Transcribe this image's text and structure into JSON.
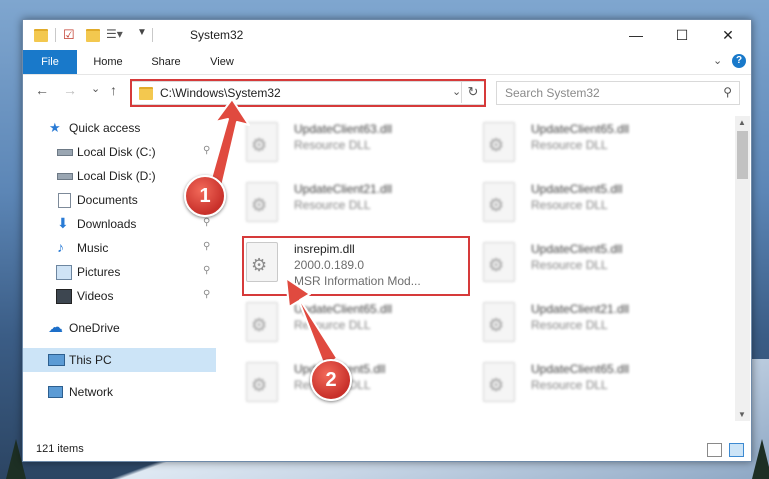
{
  "window": {
    "title": "System32",
    "controls": {
      "minimize": "—",
      "maximize": "☐",
      "close": "✕"
    }
  },
  "ribbon": {
    "tabs": [
      "File",
      "Home",
      "Share",
      "View"
    ],
    "expand_glyph": "⌄",
    "help_glyph": "?"
  },
  "addressbar": {
    "path": "C:\\Windows\\System32",
    "chevron": "⌄",
    "refresh_glyph": "↻"
  },
  "search": {
    "placeholder": "Search System32"
  },
  "nav": {
    "back": "←",
    "forward": "→",
    "recent": "⌄",
    "up": "↑",
    "items": [
      {
        "label": "Quick access",
        "icon": "star-icon",
        "pinned": false
      },
      {
        "label": "Local Disk (C:)",
        "icon": "drive-icon",
        "pinned": true
      },
      {
        "label": "Local Disk (D:)",
        "icon": "drive-icon",
        "pinned": false
      },
      {
        "label": "Documents",
        "icon": "documents-icon",
        "pinned": true
      },
      {
        "label": "Downloads",
        "icon": "download-icon",
        "pinned": true
      },
      {
        "label": "Music",
        "icon": "music-icon",
        "pinned": true
      },
      {
        "label": "Pictures",
        "icon": "pictures-icon",
        "pinned": true
      },
      {
        "label": "Videos",
        "icon": "videos-icon",
        "pinned": true
      },
      {
        "label": "OneDrive",
        "icon": "cloud-icon",
        "pinned": false
      },
      {
        "label": "This PC",
        "icon": "computer-icon",
        "pinned": false,
        "selected": true
      },
      {
        "label": "Network",
        "icon": "network-icon",
        "pinned": false
      }
    ],
    "pin_glyph": "📌"
  },
  "files": {
    "left": [
      {
        "name": "UpdateClient63.dll",
        "type": "Resource DLL",
        "blurred": true
      },
      {
        "name": "UpdateClient21.dll",
        "type": "Resource DLL",
        "blurred": true
      },
      {
        "name": "insrepim.dll",
        "type": "2000.0.189.0",
        "desc": "MSR Information Mod...",
        "blurred": false
      },
      {
        "name": "UpdateClient65.dll",
        "type": "Resource DLL",
        "blurred": true
      },
      {
        "name": "UpdateClient5.dll",
        "type": "Resource DLL",
        "blurred": true
      }
    ],
    "right": [
      {
        "name": "UpdateClient65.dll",
        "type": "Resource DLL"
      },
      {
        "name": "UpdateClient5.dll",
        "type": "Resource DLL"
      },
      {
        "name": "UpdateClient5.dll",
        "type": "Resource DLL"
      },
      {
        "name": "UpdateClient21.dll",
        "type": "Resource DLL"
      },
      {
        "name": "UpdateClient65.dll",
        "type": "Resource DLL"
      }
    ]
  },
  "annotations": {
    "step1": "1",
    "step2": "2",
    "color": "#d63a3a"
  },
  "status": {
    "item_count": "121 items"
  }
}
